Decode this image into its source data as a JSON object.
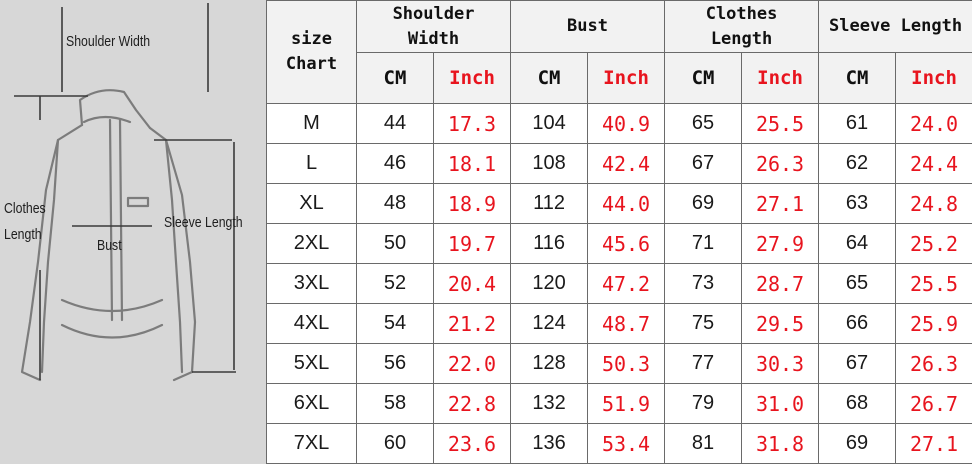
{
  "diagram": {
    "labels": {
      "shoulder": "Shoulder Width",
      "clothes_line1": "Clothes",
      "clothes_line2": "Length",
      "bust": "Bust",
      "sleeve": "Sleeve Length"
    }
  },
  "table": {
    "corner_line1": "size",
    "corner_line2": "Chart",
    "groups": [
      {
        "line1": "Shoulder",
        "line2": "Width"
      },
      {
        "line1": "Bust",
        "line2": ""
      },
      {
        "line1": "Clothes",
        "line2": "Length"
      },
      {
        "line1": "Sleeve Length",
        "line2": ""
      }
    ],
    "unit_cm": "CM",
    "unit_inch": "Inch",
    "rows": [
      {
        "size": "M",
        "vals": [
          "44",
          "17.3",
          "104",
          "40.9",
          "65",
          "25.5",
          "61",
          "24.0"
        ]
      },
      {
        "size": "L",
        "vals": [
          "46",
          "18.1",
          "108",
          "42.4",
          "67",
          "26.3",
          "62",
          "24.4"
        ]
      },
      {
        "size": "XL",
        "vals": [
          "48",
          "18.9",
          "112",
          "44.0",
          "69",
          "27.1",
          "63",
          "24.8"
        ]
      },
      {
        "size": "2XL",
        "vals": [
          "50",
          "19.7",
          "116",
          "45.6",
          "71",
          "27.9",
          "64",
          "25.2"
        ]
      },
      {
        "size": "3XL",
        "vals": [
          "52",
          "20.4",
          "120",
          "47.2",
          "73",
          "28.7",
          "65",
          "25.5"
        ]
      },
      {
        "size": "4XL",
        "vals": [
          "54",
          "21.2",
          "124",
          "48.7",
          "75",
          "29.5",
          "66",
          "25.9"
        ]
      },
      {
        "size": "5XL",
        "vals": [
          "56",
          "22.0",
          "128",
          "50.3",
          "77",
          "30.3",
          "67",
          "26.3"
        ]
      },
      {
        "size": "6XL",
        "vals": [
          "58",
          "22.8",
          "132",
          "51.9",
          "79",
          "31.0",
          "68",
          "26.7"
        ]
      },
      {
        "size": "7XL",
        "vals": [
          "60",
          "23.6",
          "136",
          "53.4",
          "81",
          "31.8",
          "69",
          "27.1"
        ]
      }
    ]
  },
  "colors": {
    "inch": "#e8141e",
    "diagram_bg": "#d7d7d7",
    "header_bg": "#f2f2f2",
    "grid": "#6a6a6a"
  }
}
